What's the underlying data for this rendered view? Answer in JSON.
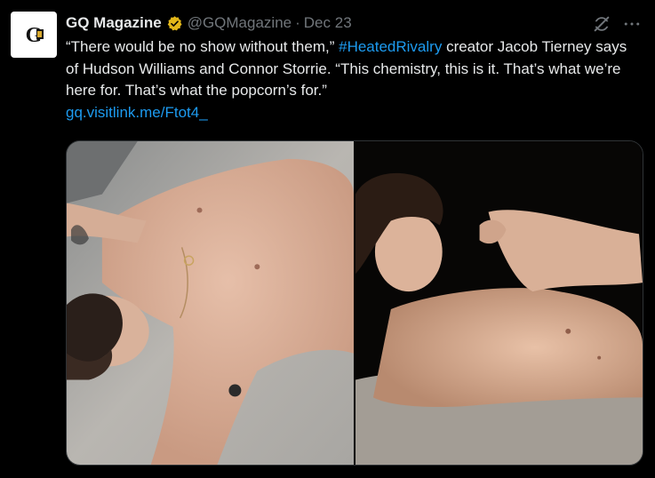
{
  "tweet": {
    "author_name": "GQ Magazine",
    "author_handle": "@GQMagazine",
    "separator": "·",
    "date": "Dec 23",
    "avatar_text": "GQ",
    "text_part1": "“There would be no show without them,” ",
    "hashtag": "#HeatedRivalry",
    "text_part2": " creator Jacob Tierney says of Hudson Williams and Connor Storrie. “This chemistry, this is it. That’s what we’re here for. That’s what the popcorn’s for.”",
    "link": "gq.visitlink.me/Ftot4_"
  },
  "icons": {
    "verified": "verified-badge-icon",
    "grok": "grok-icon",
    "more": "more-icon"
  },
  "colors": {
    "background": "#000000",
    "text": "#e7e9ea",
    "muted": "#71767b",
    "link": "#1d9bf0",
    "verified_gold": "#e2b719"
  }
}
